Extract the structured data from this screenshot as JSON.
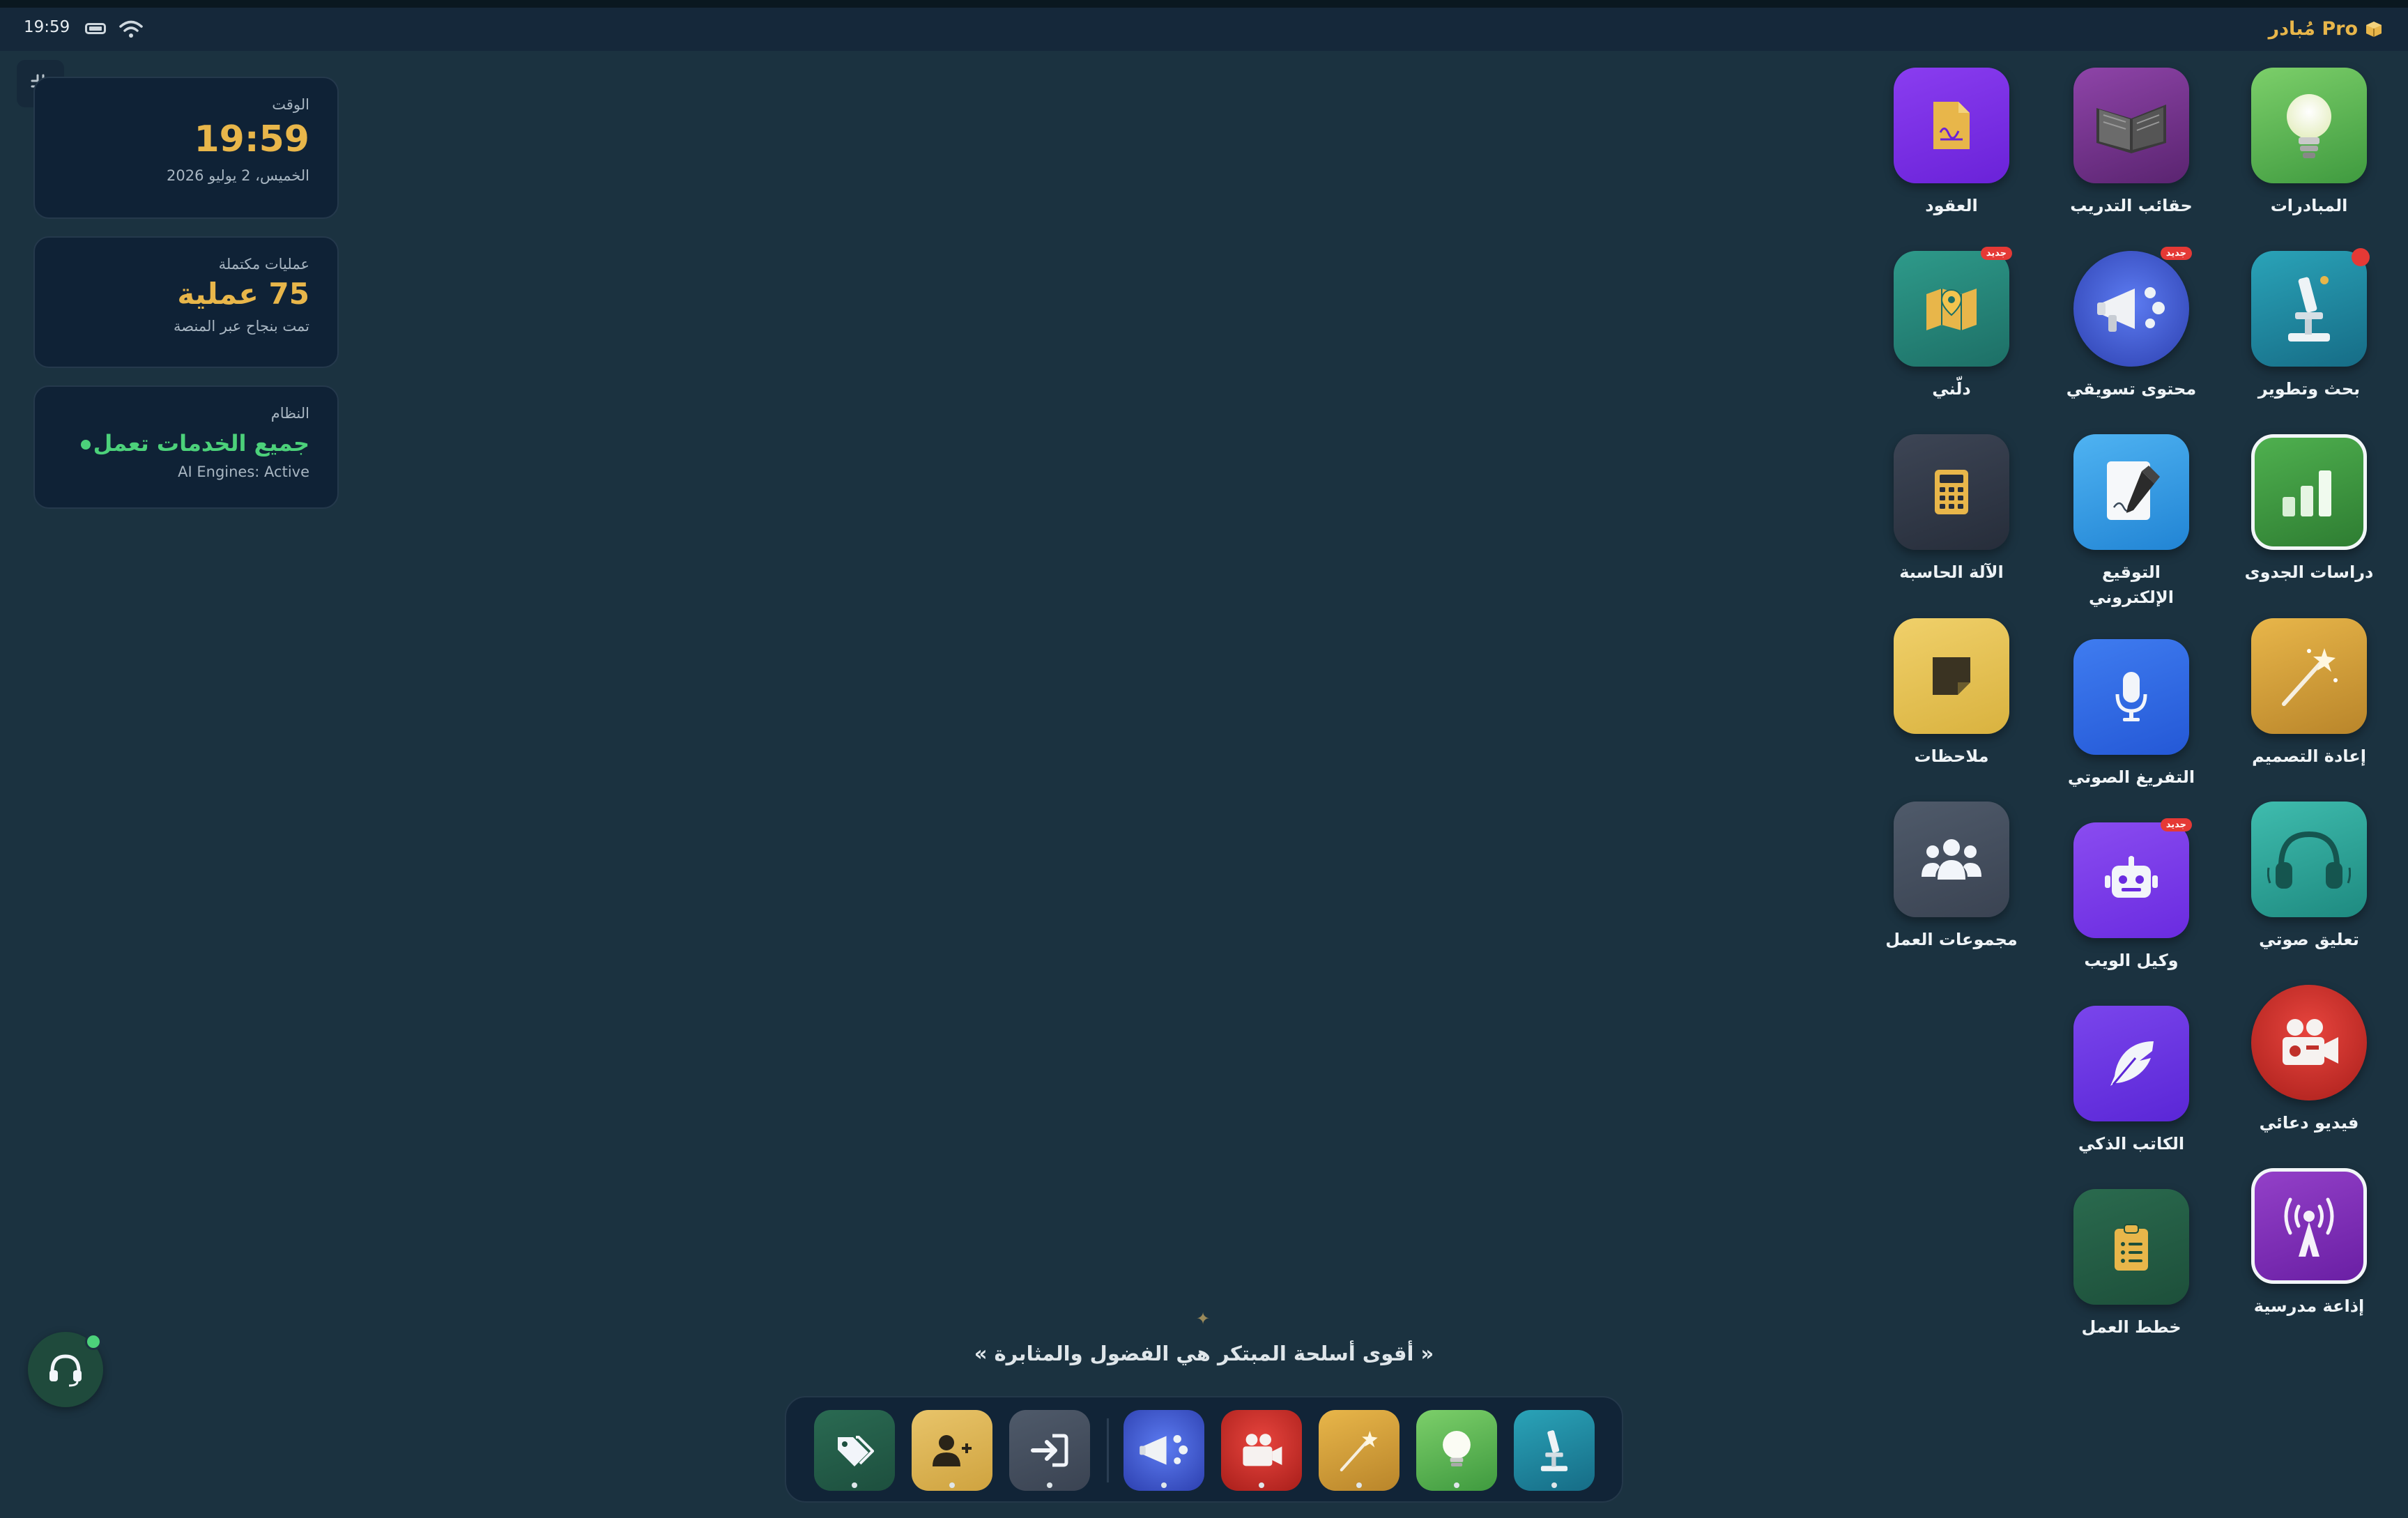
{
  "status_bar": {
    "time": "19:59"
  },
  "brand": {
    "name": "مُبادر Pro"
  },
  "widgets": {
    "time": {
      "label": "الوقت",
      "value": "19:59",
      "date": "الخميس، 2 يوليو 2026"
    },
    "operations": {
      "label": "عمليات مكتملة",
      "value": "75 عملية",
      "sub": "تمت بنجاح عبر المنصة"
    },
    "system": {
      "label": "النظام",
      "value": "جميع الخدمات تعمل",
      "sub": "AI Engines: Active"
    }
  },
  "apps": [
    {
      "id": "initiatives",
      "label": "المبادرات",
      "icon": "lightbulb-icon"
    },
    {
      "id": "training",
      "label": "حقائب التدريب",
      "icon": "open-book-icon"
    },
    {
      "id": "contracts",
      "label": "العقود",
      "icon": "contract-icon"
    },
    {
      "id": "rnd",
      "label": "بحث وتطوير",
      "icon": "microscope-icon"
    },
    {
      "id": "marketing",
      "label": "محتوى تسويقي",
      "icon": "megaphone-icon",
      "badge": "جديد"
    },
    {
      "id": "guide",
      "label": "دلّني",
      "icon": "map-pin-icon",
      "badge": "جديد"
    },
    {
      "id": "feasibility",
      "label": "دراسات الجدوى",
      "icon": "bar-chart-icon"
    },
    {
      "id": "esign",
      "label": "التوقيع الإلكتروني",
      "icon": "signature-icon"
    },
    {
      "id": "calculator",
      "label": "الآلة الحاسبة",
      "icon": "calculator-icon"
    },
    {
      "id": "redesign",
      "label": "إعادة التصميم",
      "icon": "magic-wand-icon"
    },
    {
      "id": "transcription",
      "label": "التفريغ الصوتي",
      "icon": "microphone-icon"
    },
    {
      "id": "notes",
      "label": "ملاحظات",
      "icon": "sticky-note-icon"
    },
    {
      "id": "voiceover",
      "label": "تعليق صوتي",
      "icon": "headphones-icon"
    },
    {
      "id": "web_agent",
      "label": "وكيل الويب",
      "icon": "robot-icon",
      "badge": "جديد"
    },
    {
      "id": "workgroups",
      "label": "مجموعات العمل",
      "icon": "users-icon"
    },
    {
      "id": "promo_video",
      "label": "فيديو دعائي",
      "icon": "video-camera-icon"
    },
    {
      "id": "smart_writer",
      "label": "الكاتب الذكي",
      "icon": "feather-icon"
    },
    {
      "id": "school_radio",
      "label": "إذاعة مدرسية",
      "icon": "broadcast-icon"
    },
    {
      "id": "action_plans",
      "label": "خطط العمل",
      "icon": "clipboard-list-icon"
    }
  ],
  "quote": "« أقوى أسلحة المبتكر هي الفضول والمثابرة »",
  "dock": [
    {
      "name": "tags",
      "icon": "tags-icon"
    },
    {
      "name": "add-user",
      "icon": "user-plus-icon"
    },
    {
      "name": "sign-in",
      "icon": "sign-in-icon"
    },
    {
      "name": "marketing",
      "icon": "megaphone-icon"
    },
    {
      "name": "promo-video",
      "icon": "video-camera-icon"
    },
    {
      "name": "redesign",
      "icon": "magic-wand-icon"
    },
    {
      "name": "initiatives",
      "icon": "lightbulb-icon"
    },
    {
      "name": "rnd",
      "icon": "microscope-icon"
    }
  ],
  "colors": {
    "background": "#1b3240",
    "accent_gold": "#e8b64a",
    "status_green": "#4cd17a",
    "badge_red": "#e53935"
  }
}
